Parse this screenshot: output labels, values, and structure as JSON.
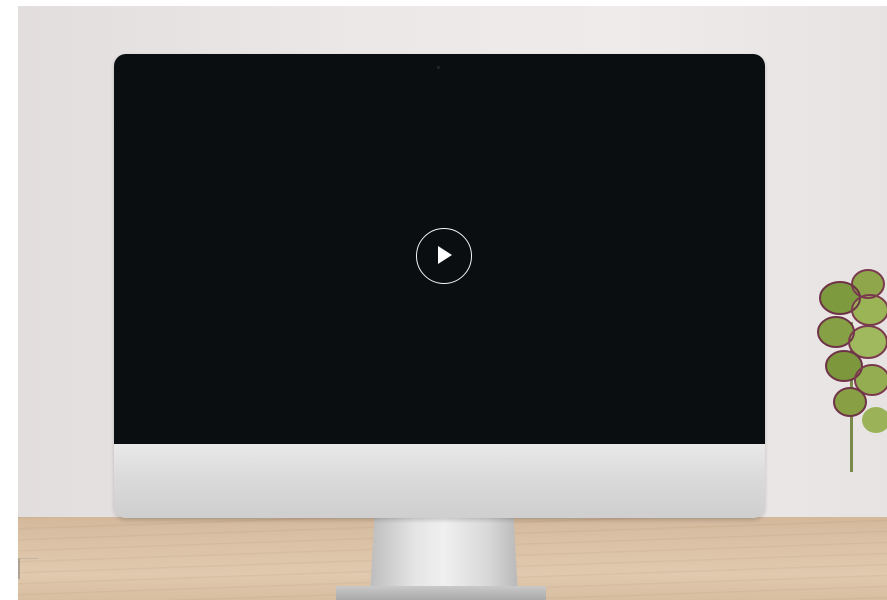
{
  "scene": {
    "subject": "desktop-monitor-mockup",
    "screen_state": "video-paused",
    "colors": {
      "screen": "#0a0e11",
      "wall": "#ece8e8",
      "desk": "#dcc3a7",
      "bezel": "#dcdcdc",
      "play_icon": "#ffffff"
    }
  },
  "player": {
    "control_icon": "play-icon"
  },
  "decor": {
    "right_edge": "plant-icon",
    "left_edge": "glass-icon"
  }
}
